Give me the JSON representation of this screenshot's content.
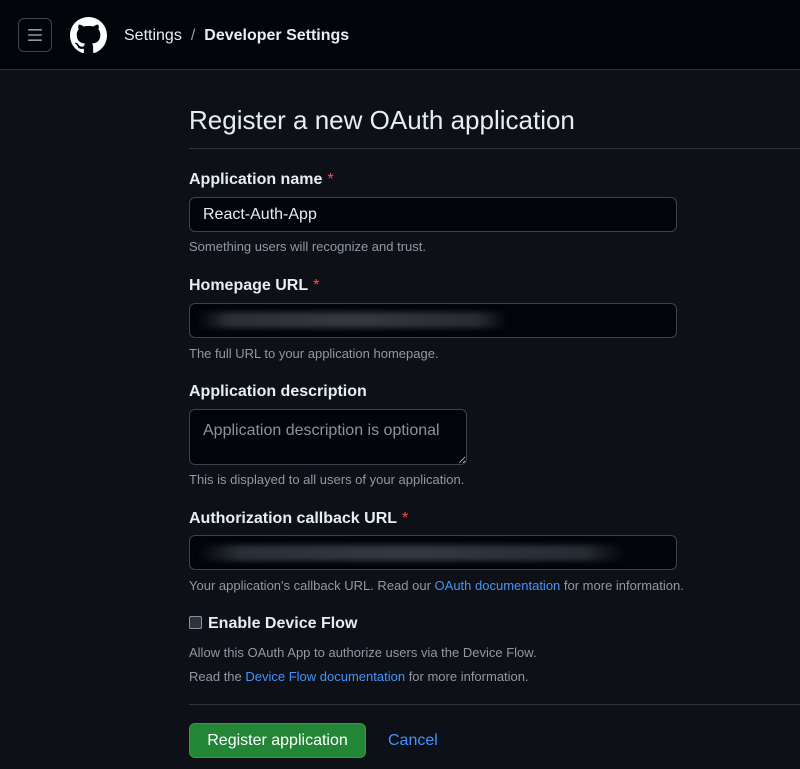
{
  "header": {
    "breadcrumb": {
      "parent": "Settings",
      "separator": "/",
      "current": "Developer Settings"
    },
    "icons": {
      "menu": "hamburger-menu-icon",
      "logo": "github-logo-icon"
    }
  },
  "form": {
    "title": "Register a new OAuth application",
    "app_name": {
      "label": "Application name",
      "required_mark": "*",
      "value": "React-Auth-App",
      "note": "Something users will recognize and trust."
    },
    "homepage_url": {
      "label": "Homepage URL",
      "required_mark": "*",
      "note": "The full URL to your application homepage."
    },
    "description": {
      "label": "Application description",
      "placeholder": "Application description is optional",
      "note": "This is displayed to all users of your application."
    },
    "callback_url": {
      "label": "Authorization callback URL",
      "required_mark": "*",
      "note_before": "Your application's callback URL. Read our ",
      "note_link": "OAuth documentation",
      "note_after": " for more information."
    },
    "device_flow": {
      "label": "Enable Device Flow",
      "checked": false,
      "note_line1": "Allow this OAuth App to authorize users via the Device Flow.",
      "note_line2_before": "Read the ",
      "note_line2_link": "Device Flow documentation",
      "note_line2_after": " for more information."
    },
    "actions": {
      "register_label": "Register application",
      "cancel_label": "Cancel"
    }
  },
  "colors": {
    "header_bg": "#010409",
    "page_bg": "#0d1117",
    "primary_button": "#238636",
    "link": "#4493f8",
    "required": "#f85149"
  }
}
